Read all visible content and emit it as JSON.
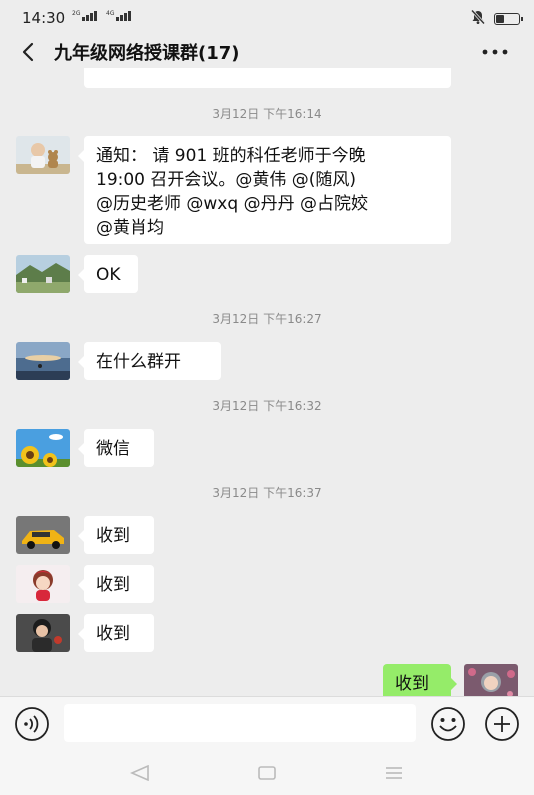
{
  "status_bar": {
    "time": "14:30",
    "signal_1_tag": "2G",
    "signal_2_tag": "4G"
  },
  "title_bar": {
    "title": "九年级网络授课群(17)",
    "back_icon": "chevron-left-icon",
    "more_icon": "more-horizontal-icon"
  },
  "messages": [
    {
      "type": "timestamp",
      "text": "3月12日 下午16:14"
    },
    {
      "type": "text",
      "side": "left",
      "avatar": "avatar-child-teddy",
      "lines": [
        "通知： 请 901 班的科任老师于今晚",
        "19:00 召开会议。@黄伟  @(随风)",
        "@历史老师  @wxq @丹丹  @占院姣",
        " @黄肖均"
      ]
    },
    {
      "type": "text",
      "side": "left",
      "avatar": "avatar-landscape",
      "text": "OK"
    },
    {
      "type": "timestamp",
      "text": "3月12日 下午16:27"
    },
    {
      "type": "text",
      "side": "left",
      "avatar": "avatar-seaside",
      "text": "在什么群开"
    },
    {
      "type": "timestamp",
      "text": "3月12日 下午16:32"
    },
    {
      "type": "text",
      "side": "left",
      "avatar": "avatar-sunflower",
      "text": "微信"
    },
    {
      "type": "timestamp",
      "text": "3月12日 下午16:37"
    },
    {
      "type": "text",
      "side": "left",
      "avatar": "avatar-car",
      "text": "收到"
    },
    {
      "type": "text",
      "side": "left",
      "avatar": "avatar-cartoon-girl",
      "text": "收到"
    },
    {
      "type": "text",
      "side": "left",
      "avatar": "avatar-woman",
      "text": "收到"
    },
    {
      "type": "text",
      "side": "right",
      "avatar": "avatar-self",
      "text": "收到"
    }
  ],
  "input_bar": {
    "voice_icon": "voice-icon",
    "placeholder": "",
    "value": "",
    "emoji_icon": "emoji-icon",
    "plus_icon": "plus-icon"
  },
  "nav_bar": {
    "back_icon": "triangle-back-icon",
    "home_icon": "square-home-icon",
    "menu_icon": "menu-lines-icon"
  },
  "colors": {
    "background": "#ededed",
    "bubble_self": "#95ec69",
    "bubble_other": "#ffffff",
    "timestamp_text": "#8a8a8a"
  }
}
